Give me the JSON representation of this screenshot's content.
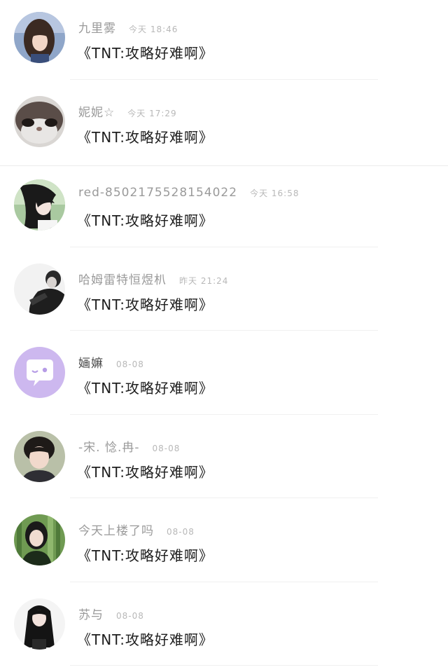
{
  "comments": [
    {
      "name": "九里雾",
      "time": "今天 18:46",
      "message": "《TNT:攻略好难啊》",
      "avatar": "avatar-girl-bangs-icon"
    },
    {
      "name": "妮妮☆",
      "time": "今天 17:29",
      "message": "《TNT:攻略好难啊》",
      "avatar": "avatar-cat-face-icon"
    },
    {
      "name": "red-8502175528154022",
      "time": "今天 16:58",
      "message": "《TNT:攻略好难啊》",
      "avatar": "avatar-windswept-hair-icon"
    },
    {
      "name": "哈姆雷特恒煜朳",
      "time": "昨天 21:24",
      "message": "《TNT:攻略好难啊》",
      "avatar": "avatar-man-suit-icon"
    },
    {
      "name": "婳嫲",
      "time": "08-08",
      "message": "《TNT:攻略好难啊》",
      "avatar": "avatar-chat-bubble-icon"
    },
    {
      "name": "-宋. 惗.冉-",
      "time": "08-08",
      "message": "《TNT:攻略好难啊》",
      "avatar": "avatar-young-man-icon"
    },
    {
      "name": "今天上楼了吗",
      "time": "08-08",
      "message": "《TNT:攻略好难啊》",
      "avatar": "avatar-bamboo-girl-icon"
    },
    {
      "name": "苏与",
      "time": "08-08",
      "message": "《TNT:攻略好难啊》",
      "avatar": "avatar-longhair-girl-icon"
    }
  ],
  "colors": {
    "name": "#9a9a9a",
    "time": "#b8b8b8",
    "message": "#1e1e1e",
    "chat_bubble_bg": "#cdb8ef"
  }
}
